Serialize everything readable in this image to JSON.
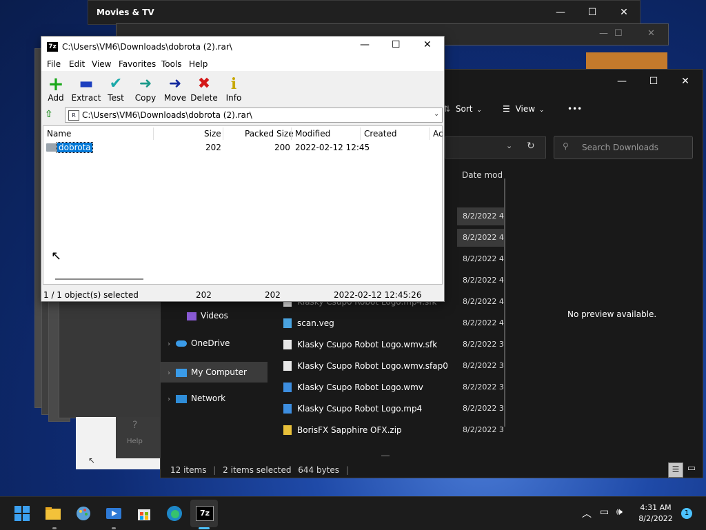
{
  "movies_window": {
    "title": "Movies & TV"
  },
  "explorer": {
    "toolbar": {
      "sort_label": "Sort",
      "view_label": "View",
      "more_label": "•••"
    },
    "search_placeholder": "Search Downloads",
    "column_date": "Date mod",
    "preview_text": "No preview available.",
    "nav": [
      {
        "label": "Videos"
      },
      {
        "label": "OneDrive"
      },
      {
        "label": "My Computer"
      },
      {
        "label": "Network"
      }
    ],
    "files": [
      {
        "name": "Klasky Csupo Robot Logo.mp4.sfk",
        "date": "8/2/2022 4"
      },
      {
        "name": "scan.veg",
        "date": "8/2/2022 4"
      },
      {
        "name": "Klasky Csupo Robot Logo.wmv.sfk",
        "date": "8/2/2022 3"
      },
      {
        "name": "Klasky Csupo Robot Logo.wmv.sfap0",
        "date": "8/2/2022 3"
      },
      {
        "name": "Klasky Csupo Robot Logo.wmv",
        "date": "8/2/2022 3"
      },
      {
        "name": "Klasky Csupo Robot Logo.mp4",
        "date": "8/2/2022 3"
      },
      {
        "name": "BorisFX Sapphire OFX.zip",
        "date": "8/2/2022 3"
      }
    ],
    "upper_dates": [
      "8/2/2022 4",
      "8/2/2022 4",
      "8/2/2022 4",
      "8/2/2022 4"
    ],
    "status": {
      "items": "12 items",
      "selected": "2 items selected",
      "size": "644 bytes"
    }
  },
  "zip": {
    "title": "C:\\Users\\VM6\\Downloads\\dobrota (2).rar\\",
    "menu": [
      "File",
      "Edit",
      "View",
      "Favorites",
      "Tools",
      "Help"
    ],
    "tools": [
      {
        "label": "Add",
        "glyph": "+",
        "color": "#1aa81a"
      },
      {
        "label": "Extract",
        "glyph": "▬",
        "color": "#1c3fbf"
      },
      {
        "label": "Test",
        "glyph": "✔",
        "color": "#1ba9a9"
      },
      {
        "label": "Copy",
        "glyph": "➜",
        "color": "#1b9a8a"
      },
      {
        "label": "Move",
        "glyph": "➜",
        "color": "#142a9e"
      },
      {
        "label": "Delete",
        "glyph": "✖",
        "color": "#d41818"
      },
      {
        "label": "Info",
        "glyph": "i",
        "color": "#c8a800"
      }
    ],
    "address": "C:\\Users\\VM6\\Downloads\\dobrota (2).rar\\",
    "columns": [
      "Name",
      "Size",
      "Packed Size",
      "Modified",
      "Created",
      "Ac"
    ],
    "row": {
      "name": "dobrota",
      "size": "202",
      "packed": "200",
      "modified": "2022-02-12 12:45"
    },
    "status": {
      "selected": "1 / 1 object(s) selected",
      "size": "202",
      "packed": "202",
      "modified": "2022-02-12 12:45:26"
    }
  },
  "help_fragment": {
    "label": "Help"
  },
  "taskbar": {
    "time": "4:31 AM",
    "date": "8/2/2022",
    "badge": "1"
  },
  "colors": {
    "accent": "#0078d4",
    "selection": "#0078d7"
  }
}
